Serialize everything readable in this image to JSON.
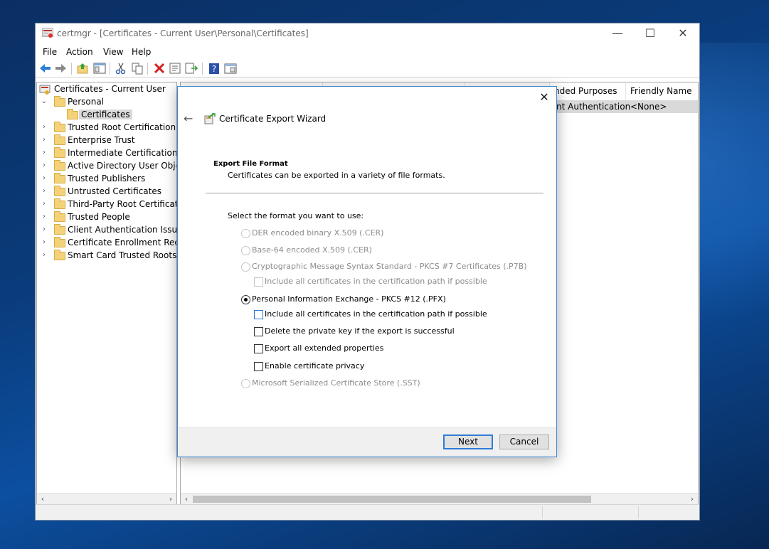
{
  "window": {
    "title": "certmgr - [Certificates - Current User\\Personal\\Certificates]",
    "controls": {
      "minimize": "—",
      "maximize": "☐",
      "close": "✕"
    }
  },
  "menu": [
    "File",
    "Action",
    "View",
    "Help"
  ],
  "toolbar": {
    "icons": [
      "back-arrow-icon",
      "forward-arrow-icon",
      "up-folder-icon",
      "show-hide-tree-icon",
      "cut-icon",
      "copy-icon",
      "delete-icon",
      "properties-icon",
      "export-list-icon",
      "help-icon",
      "console-view-icon"
    ]
  },
  "tree": {
    "root": "Certificates - Current User",
    "items": [
      {
        "label": "Personal",
        "expanded": true
      },
      {
        "label": "Certificates",
        "selected": true
      },
      {
        "label": "Trusted Root Certification Au"
      },
      {
        "label": "Enterprise Trust"
      },
      {
        "label": "Intermediate Certification Au"
      },
      {
        "label": "Active Directory User Object"
      },
      {
        "label": "Trusted Publishers"
      },
      {
        "label": "Untrusted Certificates"
      },
      {
        "label": "Third-Party Root Certificatior"
      },
      {
        "label": "Trusted People"
      },
      {
        "label": "Client Authentication Issuers"
      },
      {
        "label": "Certificate Enrollment Reques"
      },
      {
        "label": "Smart Card Trusted Roots"
      }
    ]
  },
  "list": {
    "columns": [
      "nded Purposes",
      "Friendly Name"
    ],
    "rows": [
      {
        "purposes": "nt Authentication",
        "friendly_name": "<None>"
      }
    ]
  },
  "dialog": {
    "title": "Certificate Export Wizard",
    "section_title": "Export File Format",
    "section_desc": "Certificates can be exported in a variety of file formats.",
    "prompt": "Select the format you want to use:",
    "options": {
      "der": "DER encoded binary X.509 (.CER)",
      "base64": "Base-64 encoded X.509 (.CER)",
      "pkcs7": "Cryptographic Message Syntax Standard - PKCS #7 Certificates (.P7B)",
      "pkcs7_include": "Include all certificates in the certification path if possible",
      "pfx": "Personal Information Exchange - PKCS #12 (.PFX)",
      "pfx_include": "Include all certificates in the certification path if possible",
      "pfx_delete_key": "Delete the private key if the export is successful",
      "pfx_export_props": "Export all extended properties",
      "pfx_privacy": "Enable certificate privacy",
      "sst": "Microsoft Serialized Certificate Store (.SST)"
    },
    "selected_format": "pfx",
    "buttons": {
      "next": "Next",
      "cancel": "Cancel"
    },
    "close_glyph": "✕",
    "back_glyph": "←"
  },
  "colors": {
    "accent": "#2f7bd6",
    "selection": "#d9d9d9",
    "folder": "#f4d27a"
  }
}
